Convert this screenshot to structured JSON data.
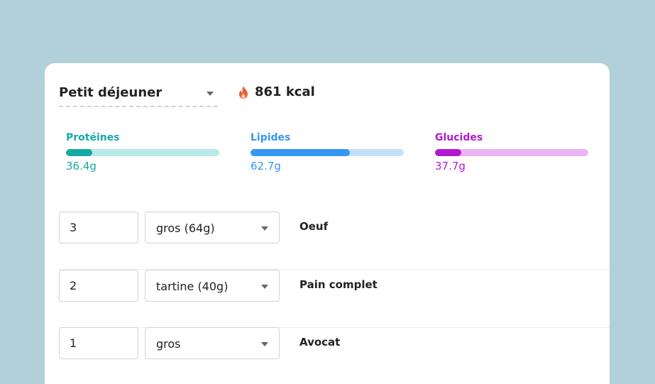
{
  "meal": {
    "name": "Petit déjeuner",
    "kcal": "861 kcal"
  },
  "macros": [
    {
      "label": "Protéines",
      "value": "36.4g",
      "fill": 0.17,
      "color": "#17a9a2",
      "track": "#b8e8e8"
    },
    {
      "label": "Lipides",
      "value": "62.7g",
      "fill": 0.65,
      "color": "#3597f1",
      "track": "#c5e0fa"
    },
    {
      "label": "Glucides",
      "value": "37.7g",
      "fill": 0.17,
      "color": "#b11ad1",
      "track": "#ebb4f3"
    }
  ],
  "foods": [
    {
      "quantity": "3",
      "unit": "gros (64g)",
      "name": "Oeuf"
    },
    {
      "quantity": "2",
      "unit": "tartine (40g)",
      "name": "Pain complet"
    },
    {
      "quantity": "1",
      "unit": "gros",
      "name": "Avocat"
    }
  ]
}
